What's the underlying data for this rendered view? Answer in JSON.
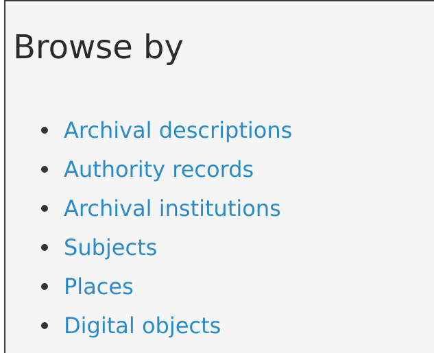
{
  "browse": {
    "title": "Browse by",
    "items": [
      {
        "label": "Archival descriptions"
      },
      {
        "label": "Authority records"
      },
      {
        "label": "Archival institutions"
      },
      {
        "label": "Subjects"
      },
      {
        "label": "Places"
      },
      {
        "label": "Digital objects"
      }
    ]
  },
  "colors": {
    "link": "#2a8bcb",
    "title": "#2b2b2b",
    "panel_background": "#f5f5f5",
    "bullet": "#333333"
  }
}
